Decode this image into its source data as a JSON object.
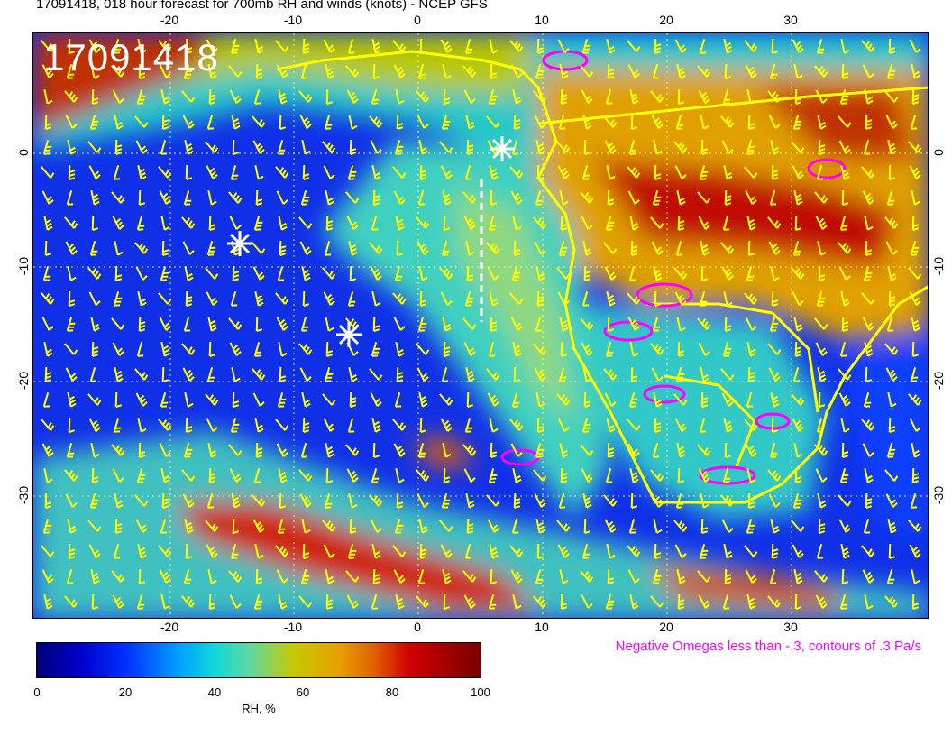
{
  "header": {
    "title": "17091418, 018 hour forecast for 700mb RH and winds (knots) - NCEP GFS"
  },
  "map": {
    "stamp": "17091418",
    "x_ticks": [
      "-20",
      "-10",
      "0",
      "10",
      "20",
      "30"
    ],
    "y_ticks": [
      "0",
      "-10",
      "-20",
      "-30"
    ],
    "markers": [
      "asterisk",
      "asterisk",
      "asterisk"
    ],
    "colors": {
      "coastline": "#ffff00",
      "wind_barbs": "#ffff00",
      "omega_contours": "#ff00ff",
      "markers": "#ffffff"
    }
  },
  "colorbar": {
    "ticks": [
      "0",
      "20",
      "40",
      "60",
      "80",
      "100"
    ],
    "label": "RH, %"
  },
  "legend": {
    "omega_note": "Negative Omegas less than -.3, contours of .3 Pa/s"
  }
}
